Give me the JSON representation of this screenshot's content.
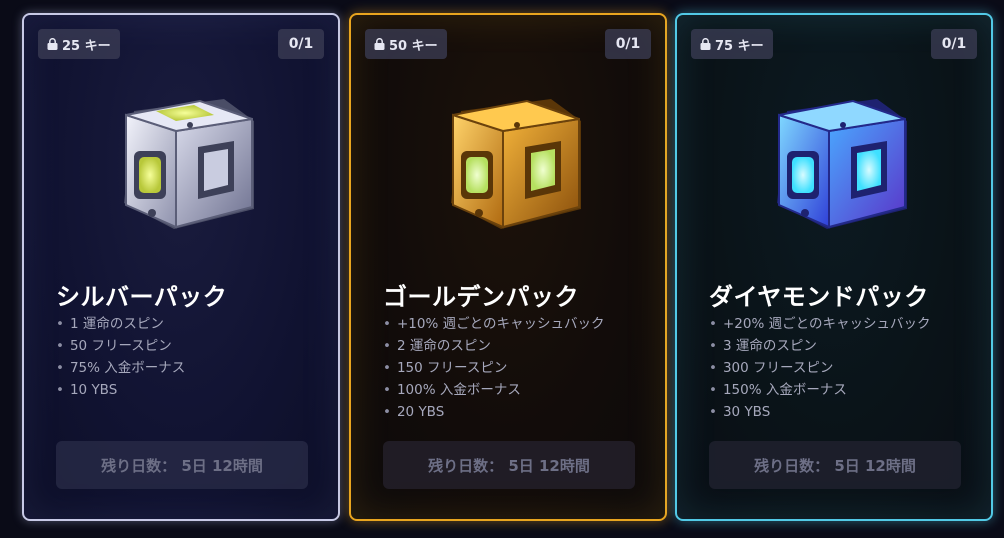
{
  "packs": [
    {
      "id": "silver",
      "keys": "25 キー",
      "count": "0/1",
      "title": "シルバーパック",
      "benefits": [
        "1 運命のスピン",
        "50 フリースピン",
        "75% 入金ボーナス",
        "10 YBS"
      ],
      "timer": "残り日数： 5日 12時間",
      "accent_color": "#c7c9e6",
      "icon": "silver-cube-icon"
    },
    {
      "id": "gold",
      "keys": "50 キー",
      "count": "0/1",
      "title": "ゴールデンパック",
      "benefits": [
        "+10% 週ごとのキャッシュバック",
        "2 運命のスピン",
        "150 フリースピン",
        "100% 入金ボーナス",
        "20 YBS"
      ],
      "timer": "残り日数： 5日 12時間",
      "accent_color": "#e9a51f",
      "icon": "gold-cube-icon"
    },
    {
      "id": "diamond",
      "keys": "75 キー",
      "count": "0/1",
      "title": "ダイヤモンドパック",
      "benefits": [
        "+20% 週ごとのキャッシュバック",
        "3 運命のスピン",
        "300 フリースピン",
        "150% 入金ボーナス",
        "30 YBS"
      ],
      "timer": "残り日数： 5日 12時間",
      "accent_color": "#52c9e6",
      "icon": "diamond-cube-icon"
    }
  ]
}
